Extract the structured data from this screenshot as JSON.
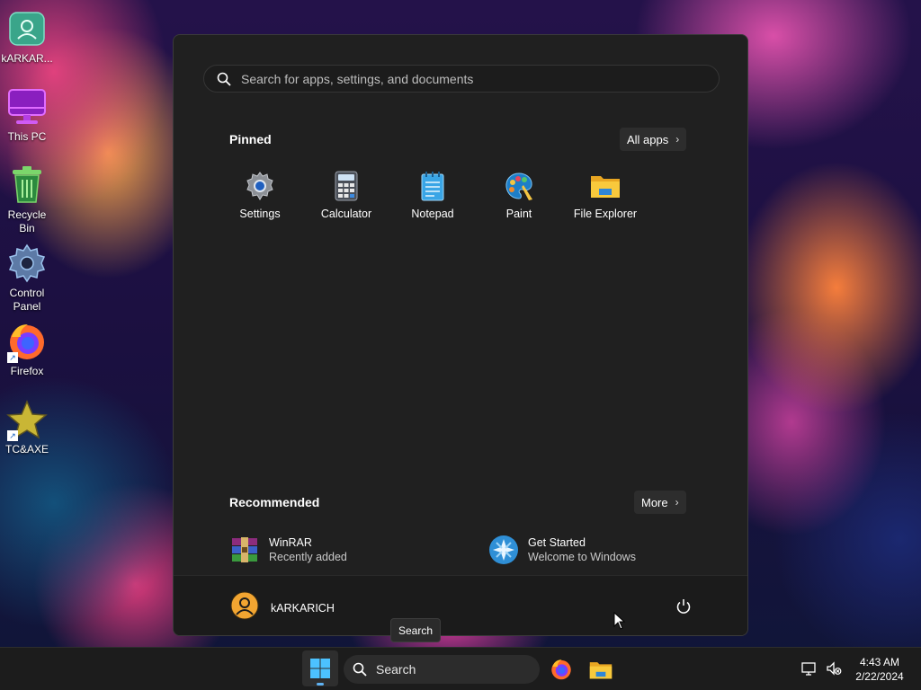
{
  "desktop": {
    "icons": [
      {
        "label": "kARKAR...",
        "icon": "user-folder-icon"
      },
      {
        "label": "This PC",
        "icon": "monitor-icon"
      },
      {
        "label": "Recycle Bin",
        "icon": "recycle-bin-icon"
      },
      {
        "label": "Control Panel",
        "icon": "gear-icon"
      },
      {
        "label": "Firefox",
        "icon": "firefox-icon"
      },
      {
        "label": "TC&AXE",
        "icon": "star-icon"
      }
    ]
  },
  "start_menu": {
    "search": {
      "placeholder": "Search for apps, settings, and documents"
    },
    "pinned": {
      "title": "Pinned",
      "all_apps_label": "All apps",
      "apps": [
        {
          "label": "Settings",
          "icon": "settings-gear-icon"
        },
        {
          "label": "Calculator",
          "icon": "calculator-icon"
        },
        {
          "label": "Notepad",
          "icon": "notepad-icon"
        },
        {
          "label": "Paint",
          "icon": "paint-palette-icon"
        },
        {
          "label": "File Explorer",
          "icon": "folder-icon"
        }
      ]
    },
    "recommended": {
      "title": "Recommended",
      "more_label": "More",
      "items": [
        {
          "name": "WinRAR",
          "subtitle": "Recently added",
          "icon": "winrar-icon"
        },
        {
          "name": "Get Started",
          "subtitle": "Welcome to Windows",
          "icon": "get-started-icon"
        }
      ]
    },
    "user": {
      "name": "kARKARICH"
    },
    "power_icon": "power-icon"
  },
  "tooltip": {
    "text": "Search"
  },
  "taskbar": {
    "search_label": "Search",
    "clock": {
      "time": "4:43 AM",
      "date": "2/22/2024"
    }
  },
  "colors": {
    "accent": "#5fb2f2",
    "menu_bg": "#202020",
    "taskbar_bg": "#1c1c1c"
  }
}
